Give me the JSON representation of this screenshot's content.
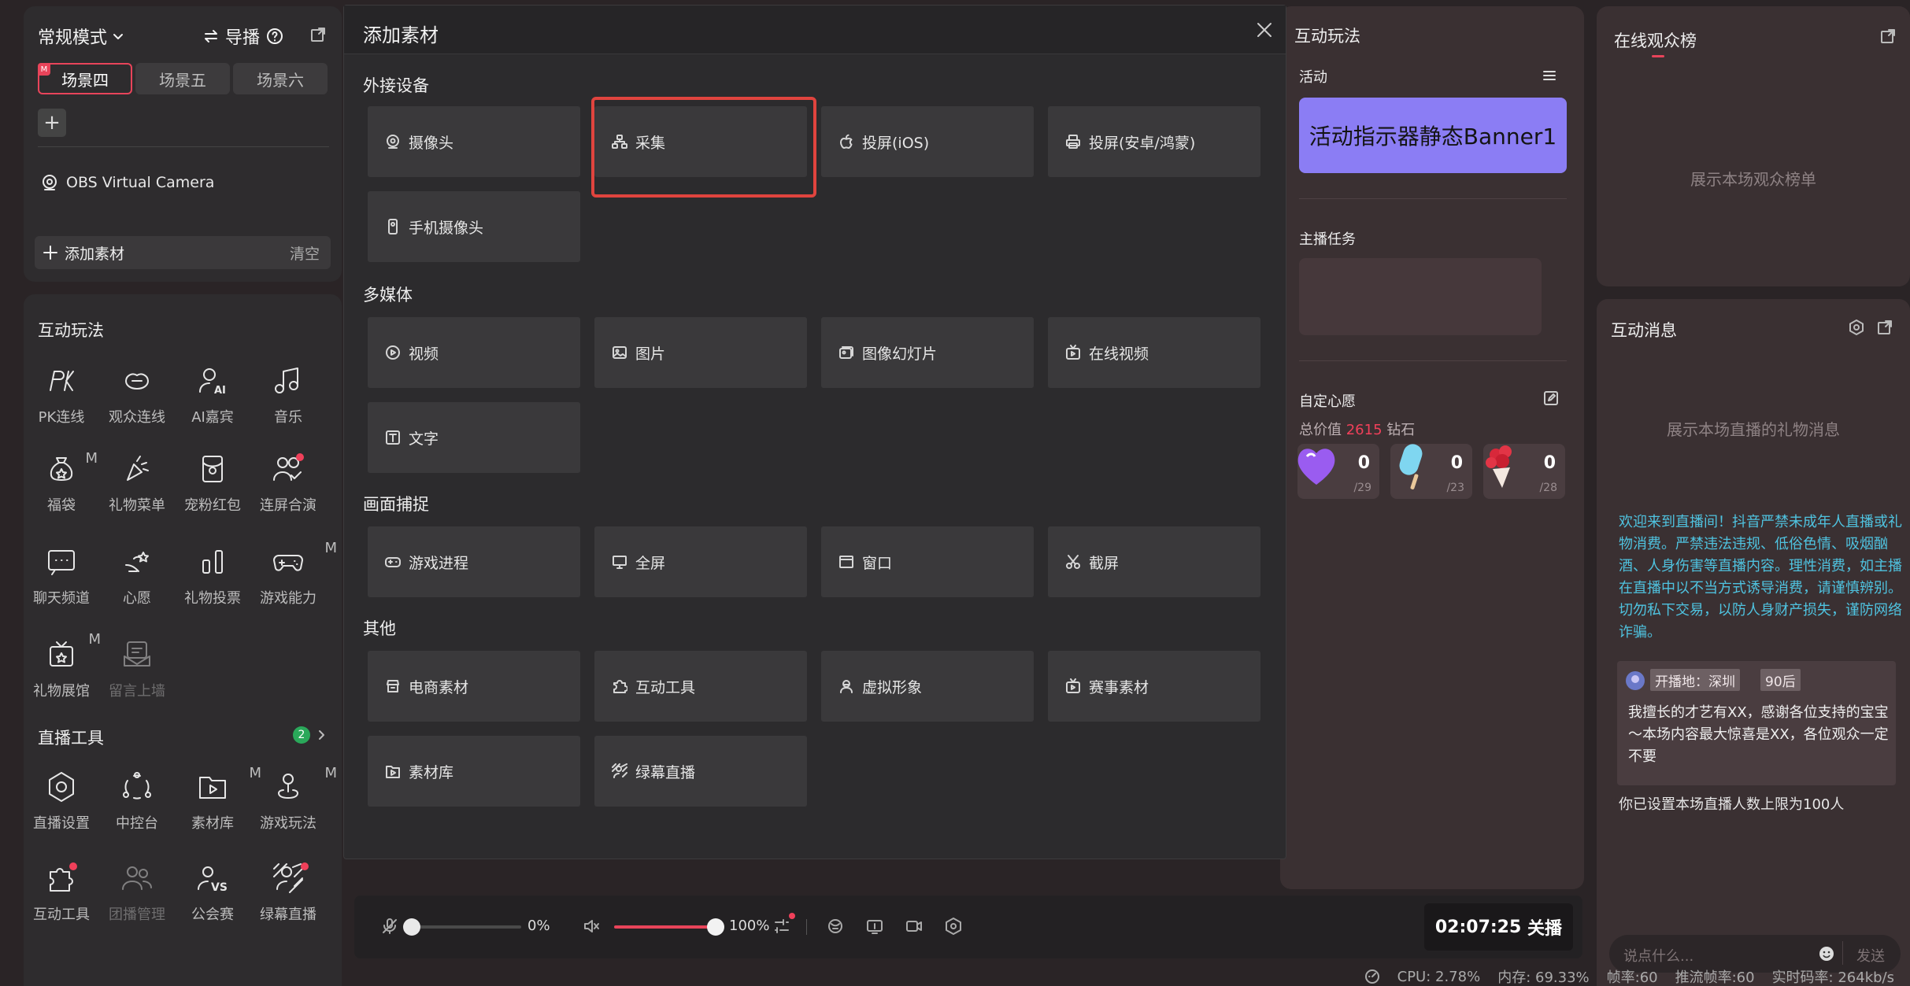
{
  "left": {
    "mode": "常规模式",
    "guide": "导播",
    "scenes": [
      "场景四",
      "场景五",
      "场景六"
    ],
    "scene_badge": "M",
    "source": "OBS Virtual Camera",
    "add_source": "添加素材",
    "clear": "清空",
    "interactive_title": "互动玩法",
    "interactive": [
      {
        "label": "PK连线",
        "icon": "pk-icon"
      },
      {
        "label": "观众连线",
        "icon": "audience-link-icon"
      },
      {
        "label": "AI嘉宾",
        "icon": "ai-guest-icon"
      },
      {
        "label": "音乐",
        "icon": "music-icon"
      },
      {
        "label": "福袋",
        "icon": "lucky-bag-icon",
        "badge": "M"
      },
      {
        "label": "礼物菜单",
        "icon": "gift-menu-icon"
      },
      {
        "label": "宠粉红包",
        "icon": "red-packet-icon"
      },
      {
        "label": "连屏合演",
        "icon": "co-stream-icon"
      },
      {
        "label": "聊天频道",
        "icon": "chat-channel-icon"
      },
      {
        "label": "心愿",
        "icon": "wish-icon"
      },
      {
        "label": "礼物投票",
        "icon": "gift-vote-icon"
      },
      {
        "label": "游戏能力",
        "icon": "game-ability-icon",
        "badge": "M"
      },
      {
        "label": "礼物展馆",
        "icon": "gift-hall-icon",
        "badge": "M"
      },
      {
        "label": "留言上墙",
        "icon": "message-wall-icon"
      }
    ],
    "tools_title": "直播工具",
    "tools_count": "2",
    "tools": [
      {
        "label": "直播设置",
        "icon": "live-settings-icon"
      },
      {
        "label": "中控台",
        "icon": "control-center-icon"
      },
      {
        "label": "素材库",
        "icon": "material-library-icon",
        "badge": "M"
      },
      {
        "label": "游戏玩法",
        "icon": "game-play-icon",
        "badge": "M"
      },
      {
        "label": "互动工具",
        "icon": "interactive-tool-icon"
      },
      {
        "label": "团播管理",
        "icon": "group-manage-icon"
      },
      {
        "label": "公会赛",
        "icon": "guild-match-icon"
      },
      {
        "label": "绿幕直播",
        "icon": "green-screen-icon"
      }
    ]
  },
  "modal": {
    "title": "添加素材",
    "sections": [
      {
        "title": "外接设备",
        "items": [
          {
            "label": "摄像头",
            "icon": "camera-icon"
          },
          {
            "label": "采集",
            "icon": "capture-icon"
          },
          {
            "label": "投屏(iOS)",
            "icon": "apple-icon"
          },
          {
            "label": "投屏(安卓/鸿蒙)",
            "icon": "android-cast-icon"
          },
          {
            "label": "手机摄像头",
            "icon": "phone-camera-icon"
          }
        ]
      },
      {
        "title": "多媒体",
        "items": [
          {
            "label": "视频",
            "icon": "video-icon"
          },
          {
            "label": "图片",
            "icon": "image-icon"
          },
          {
            "label": "图像幻灯片",
            "icon": "slideshow-icon"
          },
          {
            "label": "在线视频",
            "icon": "online-video-icon"
          },
          {
            "label": "文字",
            "icon": "text-icon"
          }
        ]
      },
      {
        "title": "画面捕捉",
        "items": [
          {
            "label": "游戏进程",
            "icon": "game-process-icon"
          },
          {
            "label": "全屏",
            "icon": "fullscreen-icon"
          },
          {
            "label": "窗口",
            "icon": "window-icon"
          },
          {
            "label": "截屏",
            "icon": "screenshot-icon"
          }
        ]
      },
      {
        "title": "其他",
        "items": [
          {
            "label": "电商素材",
            "icon": "ecommerce-icon"
          },
          {
            "label": "互动工具",
            "icon": "interactive-tool-icon"
          },
          {
            "label": "虚拟形象",
            "icon": "avatar-icon"
          },
          {
            "label": "赛事素材",
            "icon": "match-material-icon"
          },
          {
            "label": "素材库",
            "icon": "material-library-icon"
          },
          {
            "label": "绿幕直播",
            "icon": "green-screen-icon"
          }
        ]
      }
    ]
  },
  "interaction": {
    "title": "互动玩法",
    "activity": "活动",
    "banner": "活动指示器静态Banner1",
    "task": "主播任务",
    "wish": "自定心愿",
    "total_prefix": "总价值",
    "total_value": "2615",
    "total_suffix": "钻石",
    "gifts": [
      {
        "count": "0",
        "target": "/29",
        "icon": "heart-gift-icon"
      },
      {
        "count": "0",
        "target": "/23",
        "icon": "popsicle-gift-icon"
      },
      {
        "count": "0",
        "target": "/28",
        "icon": "rose-bouquet-icon"
      }
    ]
  },
  "ranking": {
    "title": "在线观众榜",
    "empty": "展示本场观众榜单"
  },
  "messages": {
    "title": "互动消息",
    "empty": "展示本场直播的礼物消息",
    "notice": "欢迎来到直播间！抖音严禁未成年人直播或礼物消费。严禁违法违规、低俗色情、吸烟酗酒、人身伤害等直播内容。理性消费，如主播在直播中以不当方式诱导消费，请谨慎辨别。切勿私下交易，以防人身财产损失，谨防网络诈骗。",
    "tags": [
      "开播地：深圳",
      "90后"
    ],
    "intro": "我擅长的才艺有XX，感谢各位支持的宝宝～本场内容最大惊喜是XX，各位观众一定不要",
    "limit": "你已设置本场直播人数上限为100人",
    "placeholder": "说点什么...",
    "send": "发送"
  },
  "bottom": {
    "mic_volume": "0%",
    "speaker_volume": "100%",
    "mic_level": 0,
    "speaker_level": 1.0,
    "timer": "02:07:25",
    "end_label": "关播"
  },
  "status": {
    "cpu": "CPU: 2.78%",
    "mem": "内存: 69.33%",
    "fps": "帧率:60",
    "push_fps": "推流帧率:60",
    "bitrate": "实时码率: 264kb/s"
  },
  "colors": {
    "accent": "#e8445a",
    "highlight": "#e0443e",
    "banner": "#8b7df4",
    "notice": "#4fc3e0",
    "value": "#f0405a"
  }
}
